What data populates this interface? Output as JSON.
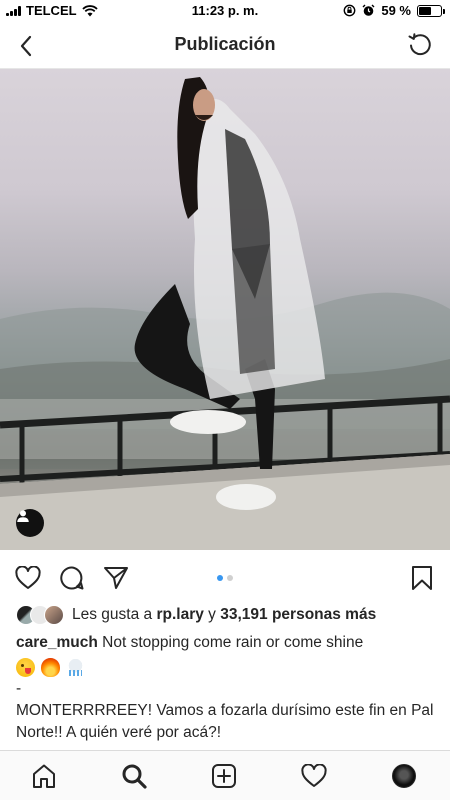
{
  "status_bar": {
    "carrier": "TELCEL",
    "time": "11:23 p. m.",
    "battery_percent": "59 %",
    "battery_level": 0.59,
    "icons": [
      "signal-icon",
      "wifi-icon",
      "orientation-lock-icon",
      "alarm-icon",
      "battery-icon"
    ]
  },
  "nav": {
    "title": "Publicación",
    "back_icon": "chevron-left-icon",
    "refresh_icon": "refresh-icon"
  },
  "post": {
    "photo_description_icon": "user-tag-icon",
    "carousel": {
      "count": 2,
      "active_index": 0
    },
    "actions": [
      "heart-icon",
      "comment-icon",
      "share-icon",
      "bookmark-icon"
    ],
    "likes": {
      "prefix": "Les gusta a",
      "first_user": "rp.lary",
      "connector": "y",
      "others": "33,191 personas más"
    },
    "caption": {
      "username": "care_much",
      "text": "Not stopping come rain or come shine",
      "emojis": [
        "winking-face-tongue-emoji",
        "fire-emoji",
        "cloud-rain-emoji"
      ],
      "dash": "-",
      "body": "MONTERRRREEY! Vamos a fozarla durísimo este fin en Pal Norte!! A quién veré por acá?!"
    }
  },
  "tabbar": {
    "items": [
      "home-icon",
      "search-icon",
      "new-post-icon",
      "activity-icon",
      "profile-icon"
    ]
  },
  "colors": {
    "accent": "#3897f0",
    "text": "#262626",
    "divider": "#dbdbdb"
  }
}
